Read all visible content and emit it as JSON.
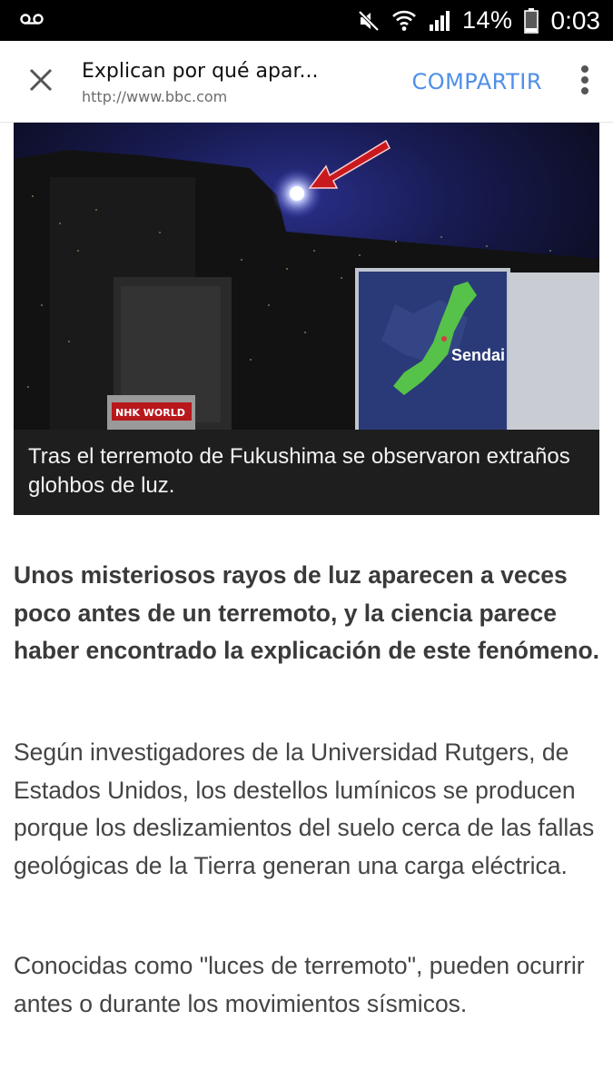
{
  "status_bar": {
    "voicemail_icon": "voicemail-icon",
    "battery": "14%",
    "time": "0:03"
  },
  "toolbar": {
    "close_icon": "close-icon",
    "title": "Explican por qué apar...",
    "url": "http://www.bbc.com",
    "share_label": "COMPARTIR",
    "menu_icon": "more-vert-icon",
    "share_color": "#4f8fe8"
  },
  "figure": {
    "broadcaster_logo": "NHK WORLD",
    "map_label": "Sendai",
    "caption": "Tras el terremoto de Fukushima se observaron extraños glohbos de luz."
  },
  "article": {
    "lead": "Unos misteriosos rayos de luz aparecen a veces poco antes de un terremoto, y la ciencia parece haber encontrado la explicación de este fenómeno.",
    "paragraphs": [
      "Según investigadores de la Universidad Rutgers, de Estados Unidos, los destellos lumínicos se producen porque los deslizamientos del suelo cerca de las fallas geológicas de la Tierra generan una carga eléctrica.",
      "Conocidas como \"luces de terremoto\", pueden ocurrir antes o durante los movimientos sísmicos."
    ]
  }
}
